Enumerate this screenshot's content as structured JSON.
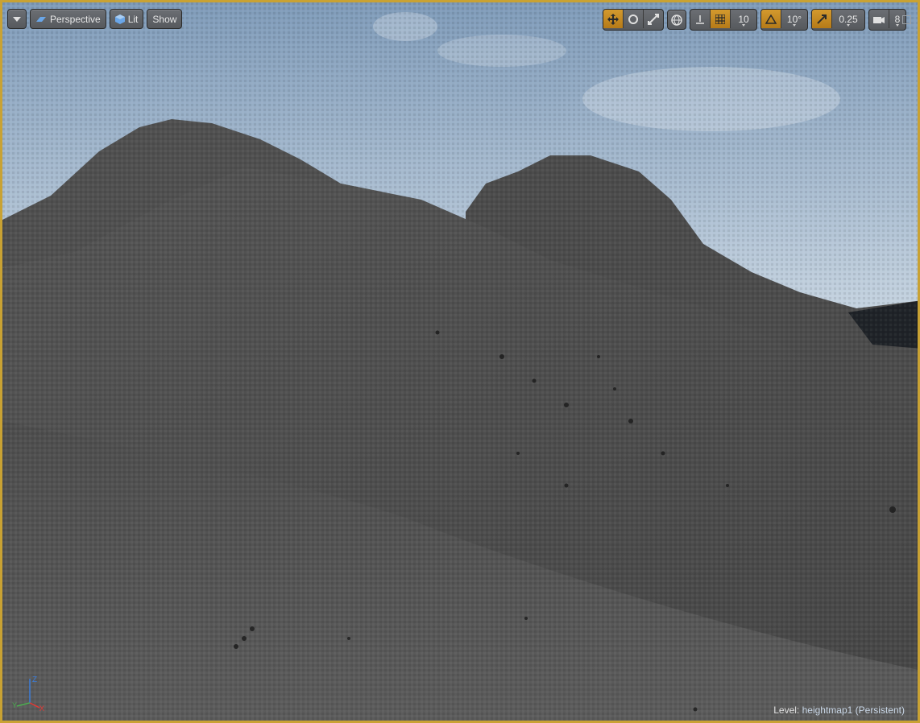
{
  "toolbar": {
    "menu_icon": "chevron-down-icon",
    "perspective_label": "Perspective",
    "lit_label": "Lit",
    "show_label": "Show",
    "grid_snap_value": "10",
    "rotation_snap_value": "10°",
    "scale_snap_value": "0.25",
    "camera_speed_value": "8"
  },
  "status": {
    "level_prefix": "Level:",
    "level_name": "heightmap1 (Persistent)"
  },
  "colors": {
    "active_accent": "#c9a233",
    "sky_top": "#7f9bb9",
    "sky_bottom": "#e7ecf0",
    "terrain": "#5a5a5a"
  }
}
